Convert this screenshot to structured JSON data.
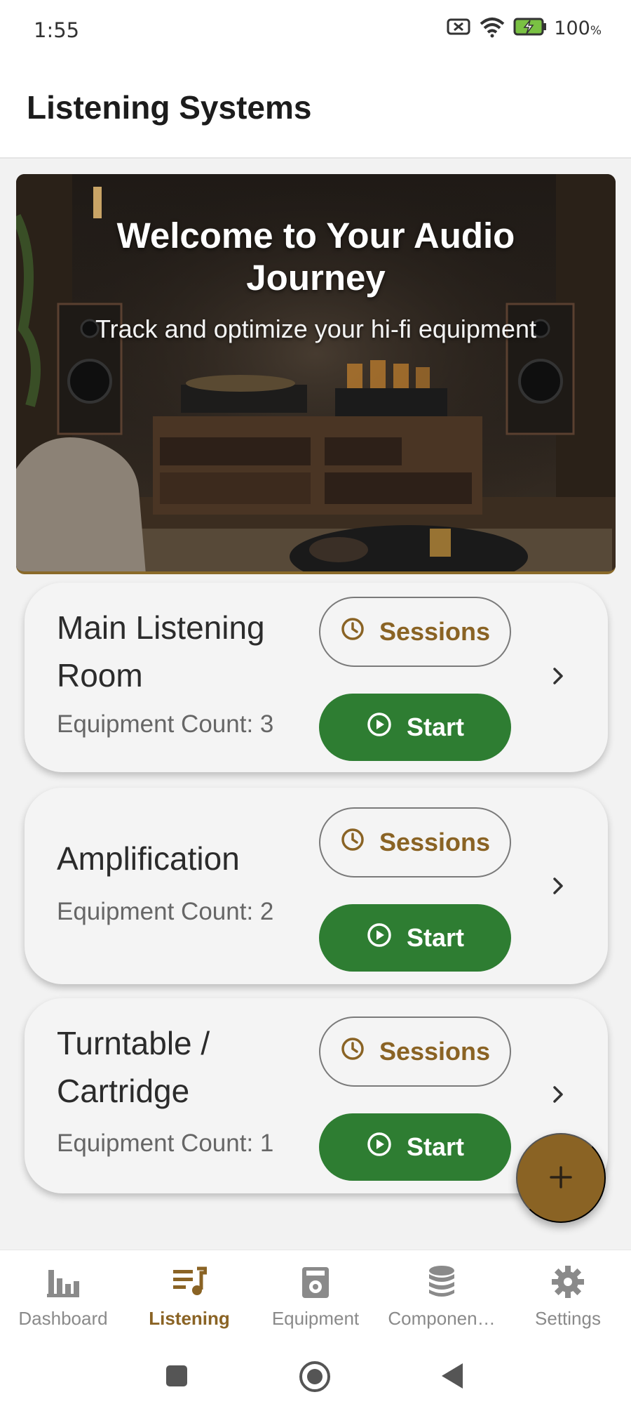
{
  "status_bar": {
    "time": "1:55",
    "battery": "100",
    "battery_unit": "%"
  },
  "app_bar": {
    "title": "Listening Systems"
  },
  "hero": {
    "title": "Welcome to Your Audio Journey",
    "subtitle": "Track and optimize your hi-fi equipment"
  },
  "systems": [
    {
      "name": "Main Listening Room",
      "count_label": "Equipment Count: 3",
      "sessions_label": "Sessions",
      "start_label": "Start"
    },
    {
      "name": "Amplification",
      "count_label": "Equipment Count: 2",
      "sessions_label": "Sessions",
      "start_label": "Start"
    },
    {
      "name": "Turntable / Cartridge",
      "count_label": "Equipment Count: 1",
      "sessions_label": "Sessions",
      "start_label": "Start"
    }
  ],
  "fab": {
    "icon": "plus-icon"
  },
  "bottom_nav": [
    {
      "label": "Dashboard",
      "icon": "bar-chart-icon",
      "active": false
    },
    {
      "label": "Listening",
      "icon": "music-list-icon",
      "active": true
    },
    {
      "label": "Equipment",
      "icon": "speaker-icon",
      "active": false
    },
    {
      "label": "Componen…",
      "icon": "database-icon",
      "active": false
    },
    {
      "label": "Settings",
      "icon": "gear-icon",
      "active": false
    }
  ],
  "colors": {
    "accent": "#8a6324",
    "start_green": "#2e7d32",
    "inactive_nav": "#8a8a8a"
  }
}
